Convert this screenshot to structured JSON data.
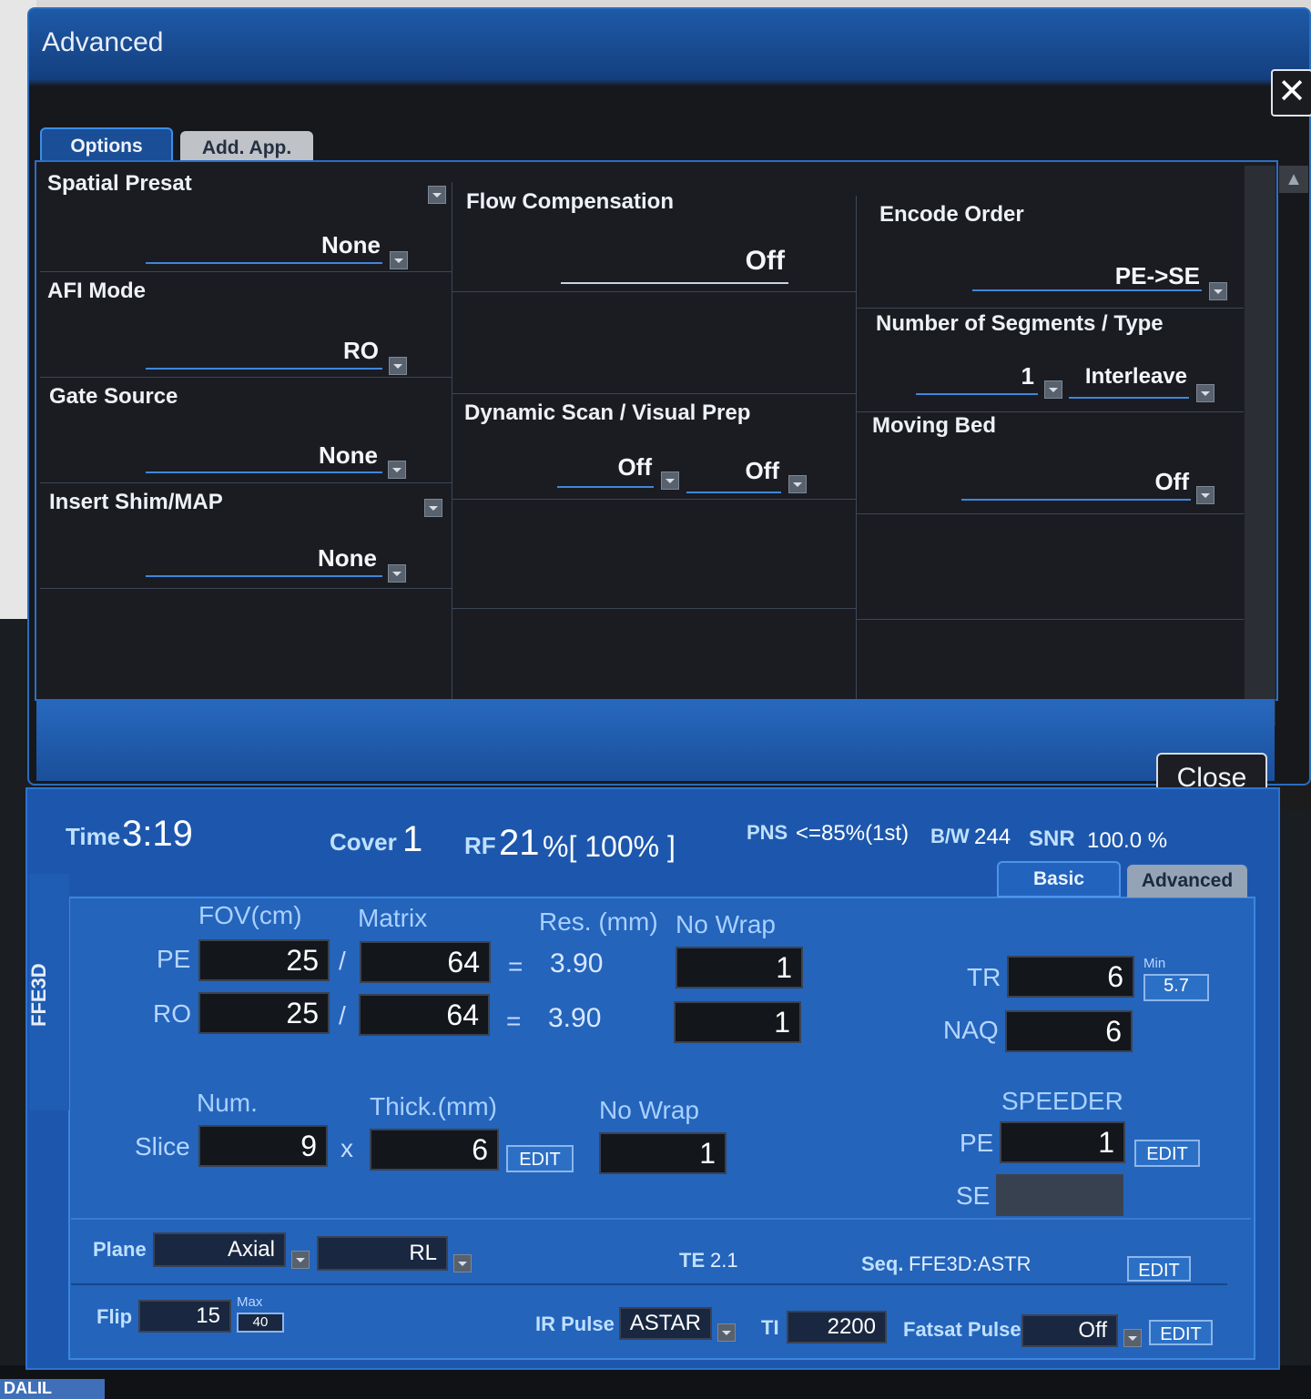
{
  "dialog": {
    "title": "Advanced",
    "close_x": "✕",
    "close_button": "Close",
    "tabs": [
      {
        "label": "Options"
      },
      {
        "label": "Add. App."
      }
    ],
    "options": {
      "spatial_presat": {
        "label": "Spatial Presat",
        "value": "None"
      },
      "afi_mode": {
        "label": "AFI Mode",
        "value": "RO"
      },
      "gate_source": {
        "label": "Gate Source",
        "value": "None"
      },
      "insert_shim": {
        "label": "Insert Shim/MAP",
        "value": "None"
      },
      "flow_comp": {
        "label": "Flow Compensation",
        "value": "Off"
      },
      "dynamic_scan": {
        "label": "Dynamic Scan / Visual Prep",
        "value1": "Off",
        "value2": "Off"
      },
      "encode_order": {
        "label": "Encode Order",
        "value": "PE->SE"
      },
      "segments": {
        "label": "Number of Segments / Type",
        "value1": "1",
        "value2": "Interleave"
      },
      "moving_bed": {
        "label": "Moving Bed",
        "value": "Off"
      }
    }
  },
  "scan": {
    "sequence_tab": "FFE3D",
    "time_label": "Time",
    "time_value": "3:19",
    "cover_label": "Cover",
    "cover_value": "1",
    "rf_label": "RF",
    "rf_value": "21",
    "rf_suffix": "%[ 100% ]",
    "pns_label": "PNS",
    "pns_value": "<=85%(1st)",
    "bw_label": "B/W",
    "bw_value": "244",
    "snr_label": "SNR",
    "snr_value": "100.0 %",
    "tabs": [
      {
        "label": "Basic"
      },
      {
        "label": "Advanced"
      }
    ],
    "headers": {
      "fov": "FOV(cm)",
      "matrix": "Matrix",
      "res": "Res. (mm)",
      "nowrap": "No Wrap"
    },
    "pe": {
      "label": "PE",
      "fov": "25",
      "matrix": "64",
      "res": "3.90",
      "nowrap": "1"
    },
    "ro": {
      "label": "RO",
      "fov": "25",
      "matrix": "64",
      "res": "3.90",
      "nowrap": "1"
    },
    "slash": "/",
    "equals": "=",
    "tr": {
      "label": "TR",
      "value": "6",
      "min_label": "Min",
      "min_value": "5.7"
    },
    "naq": {
      "label": "NAQ",
      "value": "6"
    },
    "slice_headers": {
      "num": "Num.",
      "thick": "Thick.(mm)",
      "nowrap": "No Wrap"
    },
    "slice": {
      "label": "Slice",
      "num": "9",
      "times": "x",
      "thick": "6",
      "nowrap": "1"
    },
    "edit": "EDIT",
    "speeder": {
      "label": "SPEEDER",
      "pe_label": "PE",
      "pe_value": "1",
      "se_label": "SE",
      "se_value": ""
    },
    "plane": {
      "label": "Plane",
      "value": "Axial",
      "direction": "RL"
    },
    "te": {
      "label": "TE",
      "value": "2.1"
    },
    "seq": {
      "label": "Seq.",
      "value": "FFE3D:ASTR"
    },
    "flip": {
      "label": "Flip",
      "value": "15",
      "max_label": "Max",
      "max_value": "40"
    },
    "ir_pulse": {
      "label": "IR Pulse",
      "value": "ASTAR"
    },
    "ti": {
      "label": "TI",
      "value": "2200"
    },
    "fatsat": {
      "label": "Fatsat Pulse",
      "value": "Off"
    }
  },
  "bottom_strip": "DALIL"
}
